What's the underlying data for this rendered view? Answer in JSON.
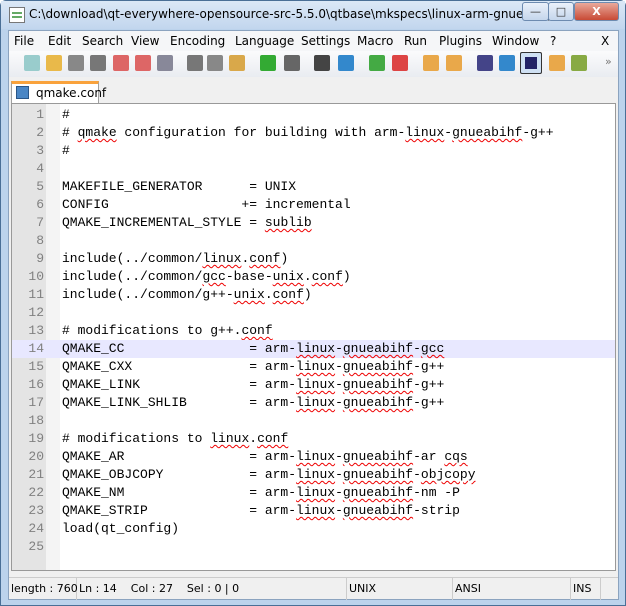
{
  "window": {
    "title": "C:\\download\\qt-everywhere-opensource-src-5.5.0\\qtbase\\mkspecs\\linux-arm-gnueabi-g...",
    "minimize": "—",
    "maximize": "□",
    "close": "X"
  },
  "menu": [
    "File",
    "Edit",
    "Search",
    "View",
    "Encoding",
    "Language",
    "Settings",
    "Macro",
    "Run",
    "Plugins",
    "Window",
    "?"
  ],
  "menu_close": "X",
  "toolbar": [
    "new-icon",
    "open-icon",
    "save-icon",
    "save-all-icon",
    "close-icon",
    "close-all-icon",
    "print-icon",
    "cut-icon",
    "copy-icon",
    "paste-icon",
    "undo-icon",
    "redo-icon",
    "find-icon",
    "replace-icon",
    "zoom-in-icon",
    "zoom-out-icon",
    "sync-vertical-icon",
    "sync-horizontal-icon",
    "word-wrap-icon",
    "show-all-chars-icon",
    "indent-guide-icon",
    "doc-map-icon",
    "function-list-icon"
  ],
  "toolbar_overflow": "»",
  "tab": {
    "label": "qmake.conf"
  },
  "current_line": 14,
  "lines": [
    [
      {
        "t": "#"
      }
    ],
    [
      {
        "t": "# "
      },
      {
        "t": "qmake",
        "sp": true
      },
      {
        "t": " configuration for building with arm-"
      },
      {
        "t": "linux",
        "sp": true
      },
      {
        "t": "-"
      },
      {
        "t": "gnueabihf",
        "sp": true
      },
      {
        "t": "-g++"
      }
    ],
    [
      {
        "t": "#"
      }
    ],
    [],
    [
      {
        "t": "MAKEFILE_GENERATOR      = UNIX"
      }
    ],
    [
      {
        "t": "CONFIG                 += incremental"
      }
    ],
    [
      {
        "t": "QMAKE_INCREMENTAL_STYLE = "
      },
      {
        "t": "sublib",
        "sp": true
      }
    ],
    [],
    [
      {
        "t": "include(../common/"
      },
      {
        "t": "linux",
        "sp": true
      },
      {
        "t": "."
      },
      {
        "t": "conf",
        "sp": true
      },
      {
        "t": ")"
      }
    ],
    [
      {
        "t": "include(../common/"
      },
      {
        "t": "gcc",
        "sp": true
      },
      {
        "t": "-base-"
      },
      {
        "t": "unix",
        "sp": true
      },
      {
        "t": "."
      },
      {
        "t": "conf",
        "sp": true
      },
      {
        "t": ")"
      }
    ],
    [
      {
        "t": "include(../common/g++-"
      },
      {
        "t": "unix",
        "sp": true
      },
      {
        "t": "."
      },
      {
        "t": "conf",
        "sp": true
      },
      {
        "t": ")"
      }
    ],
    [],
    [
      {
        "t": "# modifications to g++."
      },
      {
        "t": "conf",
        "sp": true
      }
    ],
    [
      {
        "t": "QMAKE_CC                = arm-"
      },
      {
        "t": "linux",
        "sp": true
      },
      {
        "t": "-"
      },
      {
        "t": "gnueabihf",
        "sp": true
      },
      {
        "t": "-"
      },
      {
        "t": "gcc",
        "sp": true
      }
    ],
    [
      {
        "t": "QMAKE_CXX               = arm-"
      },
      {
        "t": "linux",
        "sp": true
      },
      {
        "t": "-"
      },
      {
        "t": "gnueabihf",
        "sp": true
      },
      {
        "t": "-g++"
      }
    ],
    [
      {
        "t": "QMAKE_LINK              = arm-"
      },
      {
        "t": "linux",
        "sp": true
      },
      {
        "t": "-"
      },
      {
        "t": "gnueabihf",
        "sp": true
      },
      {
        "t": "-g++"
      }
    ],
    [
      {
        "t": "QMAKE_LINK_SHLIB        = arm-"
      },
      {
        "t": "linux",
        "sp": true
      },
      {
        "t": "-"
      },
      {
        "t": "gnueabihf",
        "sp": true
      },
      {
        "t": "-g++"
      }
    ],
    [],
    [
      {
        "t": "# modifications to "
      },
      {
        "t": "linux",
        "sp": true
      },
      {
        "t": "."
      },
      {
        "t": "conf",
        "sp": true
      }
    ],
    [
      {
        "t": "QMAKE_AR                = arm-"
      },
      {
        "t": "linux",
        "sp": true
      },
      {
        "t": "-"
      },
      {
        "t": "gnueabihf",
        "sp": true
      },
      {
        "t": "-ar "
      },
      {
        "t": "cqs",
        "sp": true
      }
    ],
    [
      {
        "t": "QMAKE_OBJCOPY           = arm-"
      },
      {
        "t": "linux",
        "sp": true
      },
      {
        "t": "-"
      },
      {
        "t": "gnueabihf",
        "sp": true
      },
      {
        "t": "-"
      },
      {
        "t": "objcopy",
        "sp": true
      }
    ],
    [
      {
        "t": "QMAKE_NM                = arm-"
      },
      {
        "t": "linux",
        "sp": true
      },
      {
        "t": "-"
      },
      {
        "t": "gnueabihf",
        "sp": true
      },
      {
        "t": "-nm -P"
      }
    ],
    [
      {
        "t": "QMAKE_STRIP             = arm-"
      },
      {
        "t": "linux",
        "sp": true
      },
      {
        "t": "-"
      },
      {
        "t": "gnueabihf",
        "sp": true
      },
      {
        "t": "-strip"
      }
    ],
    [
      {
        "t": "load(qt_config)"
      }
    ],
    []
  ],
  "status": {
    "length": "length : 760",
    "position": "Ln : 14    Col : 27    Sel : 0 | 0",
    "eol": "UNIX",
    "encoding": "ANSI",
    "mode": "INS"
  }
}
